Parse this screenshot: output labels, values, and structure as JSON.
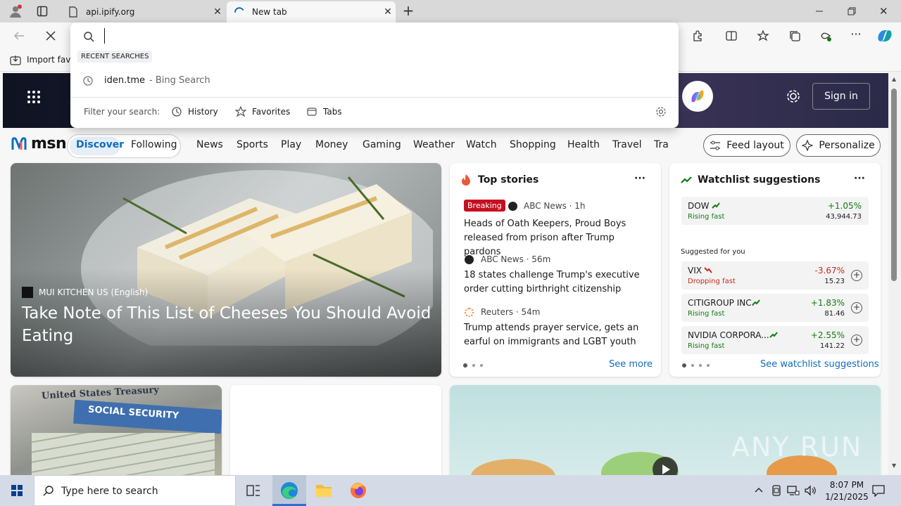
{
  "browser": {
    "tabs": [
      {
        "title": "api.ipify.org"
      },
      {
        "title": "New tab"
      }
    ],
    "favorites_bar": {
      "import_label": "Import favo"
    }
  },
  "omnibox": {
    "value": "",
    "section_label": "RECENT SEARCHES",
    "recent": [
      {
        "query": "iden.tme",
        "source": "- Bing Search"
      }
    ],
    "filter_label": "Filter your search:",
    "filters": [
      "History",
      "Favorites",
      "Tabs"
    ]
  },
  "msn": {
    "logo": "msn",
    "signin": "Sign in",
    "nav_tabs": [
      "Discover",
      "Following"
    ],
    "nav_links": [
      "News",
      "Sports",
      "Play",
      "Money",
      "Gaming",
      "Weather",
      "Watch",
      "Shopping",
      "Health",
      "Travel",
      "Tra"
    ],
    "feed_layout": "Feed layout",
    "personalize": "Personalize"
  },
  "hero_article": {
    "source": "MUI KITCHEN US (English)",
    "title": "Take Note of This List of Cheeses You Should Avoid Eating"
  },
  "top_stories": {
    "title": "Top stories",
    "breaking": "Breaking",
    "items": [
      {
        "source": "ABC News · 1h",
        "headline": "Heads of Oath Keepers, Proud Boys released from prison after Trump pardons"
      },
      {
        "source": "ABC News · 56m",
        "headline": "18 states challenge Trump's executive order cutting birthright citizenship"
      },
      {
        "source": "Reuters · 54m",
        "headline": "Trump attends prayer service, gets an earful on immigrants and LGBT youth"
      }
    ],
    "see_more": "See more"
  },
  "watchlist": {
    "title": "Watchlist suggestions",
    "suggested_label": "Suggested for you",
    "stocks": [
      {
        "name": "DOW",
        "status": "Rising fast",
        "change": "+1.05%",
        "price": "43,944.73",
        "up": true
      },
      {
        "name": "VIX",
        "status": "Dropping fast",
        "change": "-3.67%",
        "price": "15.23",
        "up": false
      },
      {
        "name": "CITIGROUP INC.",
        "status": "Rising fast",
        "change": "+1.83%",
        "price": "81.46",
        "up": true
      },
      {
        "name": "NVIDIA CORPORA...",
        "status": "Rising fast",
        "change": "+2.55%",
        "price": "141.22",
        "up": true
      }
    ],
    "see_link": "See watchlist suggestions"
  },
  "lower_cards": {
    "treasury_text": "United States Treasury",
    "social_security": "SOCIAL SECURITY",
    "watermark": "ANY RUN"
  },
  "taskbar": {
    "search_placeholder": "Type here to search",
    "time": "8:07 PM",
    "date": "1/21/2025"
  },
  "colors": {
    "accent": "#0f6cbd",
    "up": "#107c10",
    "down": "#c42b1c",
    "breaking": "#c50f1f"
  }
}
